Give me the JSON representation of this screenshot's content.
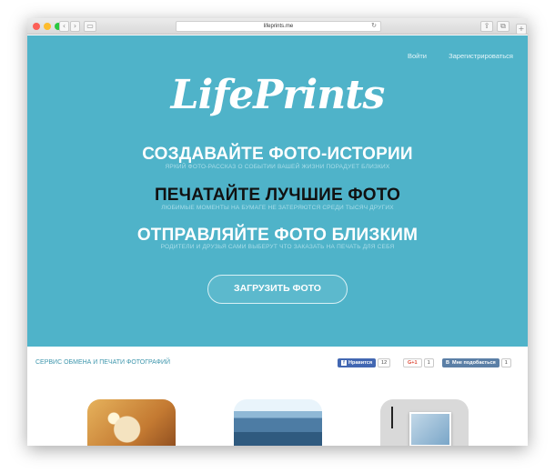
{
  "browser": {
    "url": "lifeprints.me"
  },
  "nav": {
    "login": "Войти",
    "register": "Зарегистрироваться"
  },
  "logo": "LifePrints",
  "features": [
    {
      "title": "СОЗДАВАЙТЕ ФОТО-ИСТОРИИ",
      "subtitle": "ЯРКИЙ ФОТО-РАССКАЗ О СОБЫТИИ ВАШЕЙ ЖИЗНИ ПОРАДУЕТ БЛИЗКИХ",
      "color": "#ffffff"
    },
    {
      "title": "ПЕЧАТАЙТЕ ЛУЧШИЕ ФОТО",
      "subtitle": "ЛЮБИМЫЕ МОМЕНТЫ НА БУМАГЕ НЕ ЗАТЕРЯЮТСЯ СРЕДИ ТЫСЯЧ ДРУГИХ",
      "color": "#111111"
    },
    {
      "title": "ОТПРАВЛЯЙТЕ ФОТО БЛИЗКИМ",
      "subtitle": "РОДИТЕЛИ И ДРУЗЬЯ САМИ ВЫБЕРУТ ЧТО ЗАКАЗАТЬ НА ПЕЧАТЬ ДЛЯ СЕБЯ",
      "color": "#ffffff"
    }
  ],
  "cta": "ЗАГРУЗИТЬ ФОТО",
  "strip": {
    "tagline": "СЕРВИС ОБМЕНА И ПЕЧАТИ ФОТОГРАФИЙ",
    "facebook": {
      "label": "Нравится",
      "count": "12",
      "color": "#4267b2"
    },
    "gplus": {
      "label": "G+1",
      "count": "1",
      "color": "#dd4b39"
    },
    "vk": {
      "label": "Мне подобається",
      "icon_label": "B",
      "count": "1",
      "color": "#5b7fa6"
    }
  },
  "colors": {
    "hero": "#4fb3c9",
    "accent": "#3f97ad"
  }
}
